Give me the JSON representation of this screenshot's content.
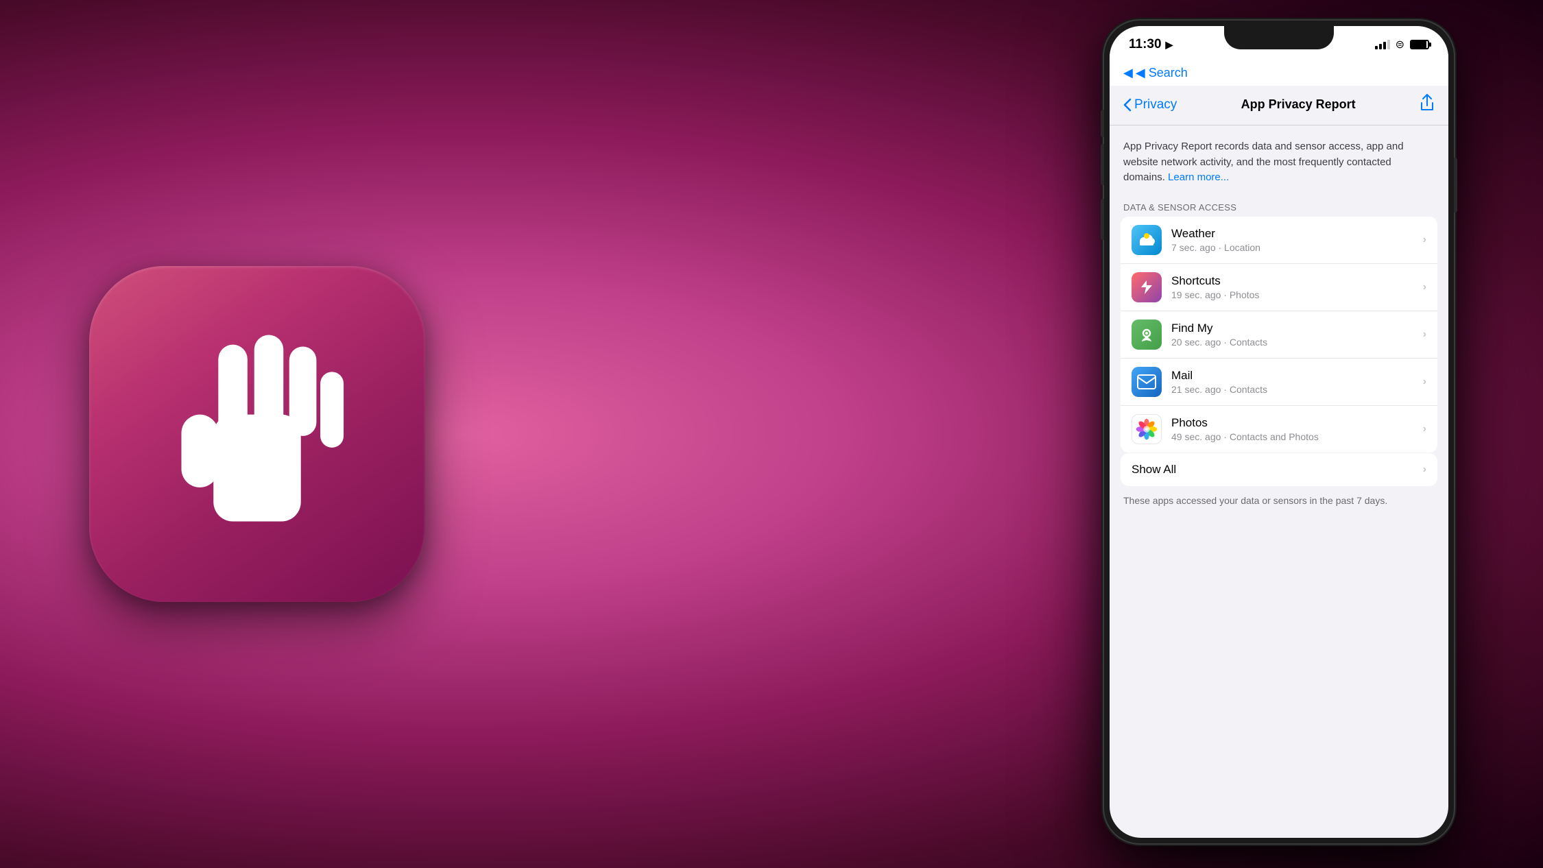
{
  "background": {
    "gradient": "radial pink-to-dark"
  },
  "app_icon": {
    "shape": "rounded-square",
    "bg_color": "#c0407a",
    "icon": "hand"
  },
  "phone": {
    "status_bar": {
      "time": "11:30",
      "location_arrow": "▶",
      "signal": "●●●",
      "wifi": "wifi",
      "battery": "full"
    },
    "search_nav": {
      "back_label": "◀ Search"
    },
    "nav": {
      "back_label": "Privacy",
      "title": "App Privacy Report",
      "share_icon": "share"
    },
    "description": {
      "text": "App Privacy Report records data and sensor access, app and website network activity, and the most frequently contacted domains.",
      "learn_more": "Learn more..."
    },
    "section_header": "DATA & SENSOR ACCESS",
    "apps": [
      {
        "name": "Weather",
        "detail": "7 sec. ago · Location",
        "icon_type": "weather"
      },
      {
        "name": "Shortcuts",
        "detail": "19 sec. ago · Photos",
        "icon_type": "shortcuts"
      },
      {
        "name": "Find My",
        "detail": "20 sec. ago · Contacts",
        "icon_type": "findmy"
      },
      {
        "name": "Mail",
        "detail": "21 sec. ago · Contacts",
        "icon_type": "mail"
      },
      {
        "name": "Photos",
        "detail": "49 sec. ago · Contacts and Photos",
        "icon_type": "photos"
      }
    ],
    "show_all": "Show All",
    "footer_note": "These apps accessed your data or sensors in the past 7 days."
  }
}
